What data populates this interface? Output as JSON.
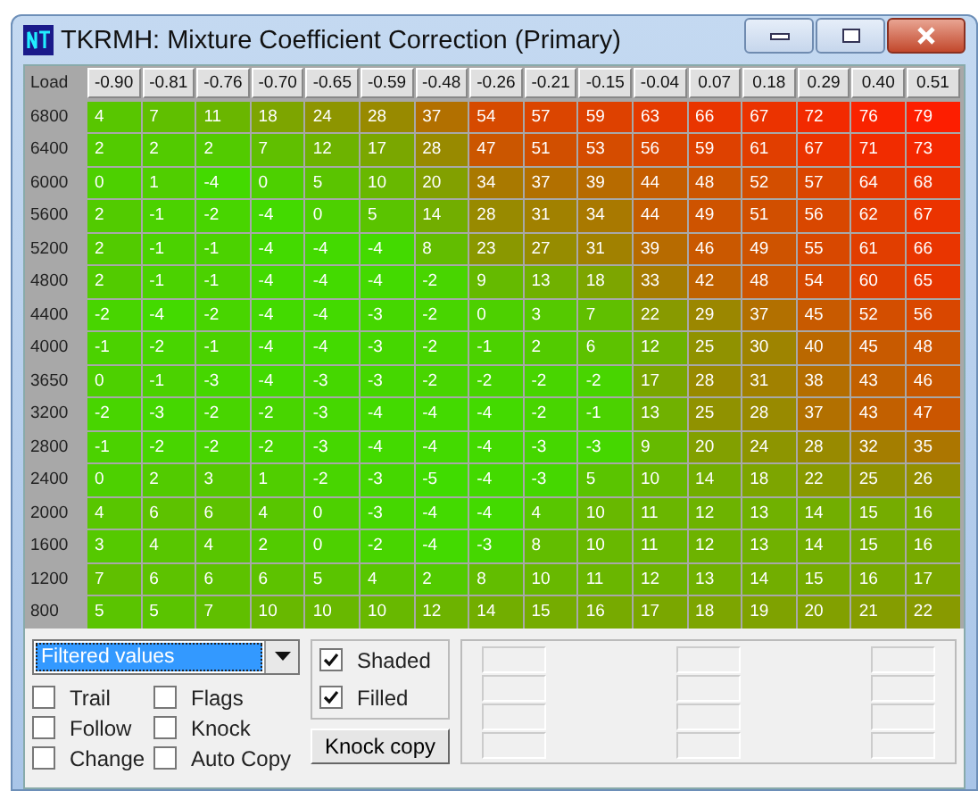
{
  "window": {
    "title": "TKRMH: Mixture Coefficient Correction (Primary)"
  },
  "table": {
    "corner": "Load",
    "columns": [
      "-0.90",
      "-0.81",
      "-0.76",
      "-0.70",
      "-0.65",
      "-0.59",
      "-0.48",
      "-0.26",
      "-0.21",
      "-0.15",
      "-0.04",
      "0.07",
      "0.18",
      "0.29",
      "0.40",
      "0.51"
    ],
    "rows": [
      {
        "label": "6800",
        "values": [
          "4",
          "7",
          "11",
          "18",
          "24",
          "28",
          "37",
          "54",
          "57",
          "59",
          "63",
          "66",
          "67",
          "72",
          "76",
          "79"
        ]
      },
      {
        "label": "6400",
        "values": [
          "2",
          "2",
          "2",
          "7",
          "12",
          "17",
          "28",
          "47",
          "51",
          "53",
          "56",
          "59",
          "61",
          "67",
          "71",
          "73"
        ]
      },
      {
        "label": "6000",
        "values": [
          "0",
          "1",
          "-4",
          "0",
          "5",
          "10",
          "20",
          "34",
          "37",
          "39",
          "44",
          "48",
          "52",
          "57",
          "64",
          "68"
        ]
      },
      {
        "label": "5600",
        "values": [
          "2",
          "-1",
          "-2",
          "-4",
          "0",
          "5",
          "14",
          "28",
          "31",
          "34",
          "44",
          "49",
          "51",
          "56",
          "62",
          "67"
        ]
      },
      {
        "label": "5200",
        "values": [
          "2",
          "-1",
          "-1",
          "-4",
          "-4",
          "-4",
          "8",
          "23",
          "27",
          "31",
          "39",
          "46",
          "49",
          "55",
          "61",
          "66"
        ]
      },
      {
        "label": "4800",
        "values": [
          "2",
          "-1",
          "-1",
          "-4",
          "-4",
          "-4",
          "-2",
          "9",
          "13",
          "18",
          "33",
          "42",
          "48",
          "54",
          "60",
          "65"
        ]
      },
      {
        "label": "4400",
        "values": [
          "-2",
          "-4",
          "-2",
          "-4",
          "-4",
          "-3",
          "-2",
          "0",
          "3",
          "7",
          "22",
          "29",
          "37",
          "45",
          "52",
          "56"
        ]
      },
      {
        "label": "4000",
        "values": [
          "-1",
          "-2",
          "-1",
          "-4",
          "-4",
          "-3",
          "-2",
          "-1",
          "2",
          "6",
          "12",
          "25",
          "30",
          "40",
          "45",
          "48"
        ]
      },
      {
        "label": "3650",
        "values": [
          "0",
          "-1",
          "-3",
          "-4",
          "-3",
          "-3",
          "-2",
          "-2",
          "-2",
          "-2",
          "17",
          "28",
          "31",
          "38",
          "43",
          "46"
        ]
      },
      {
        "label": "3200",
        "values": [
          "-2",
          "-3",
          "-2",
          "-2",
          "-3",
          "-4",
          "-4",
          "-4",
          "-2",
          "-1",
          "13",
          "25",
          "28",
          "37",
          "43",
          "47"
        ]
      },
      {
        "label": "2800",
        "values": [
          "-1",
          "-2",
          "-2",
          "-2",
          "-3",
          "-4",
          "-4",
          "-4",
          "-3",
          "-3",
          "9",
          "20",
          "24",
          "28",
          "32",
          "35"
        ]
      },
      {
        "label": "2400",
        "values": [
          "0",
          "2",
          "3",
          "1",
          "-2",
          "-3",
          "-5",
          "-4",
          "-3",
          "5",
          "10",
          "14",
          "18",
          "22",
          "25",
          "26"
        ]
      },
      {
        "label": "2000",
        "values": [
          "4",
          "6",
          "6",
          "4",
          "0",
          "-3",
          "-4",
          "-4",
          "4",
          "10",
          "11",
          "12",
          "13",
          "14",
          "15",
          "16"
        ]
      },
      {
        "label": "1600",
        "values": [
          "3",
          "4",
          "4",
          "2",
          "0",
          "-2",
          "-4",
          "-3",
          "8",
          "10",
          "11",
          "12",
          "13",
          "14",
          "15",
          "16"
        ]
      },
      {
        "label": "1200",
        "values": [
          "7",
          "6",
          "6",
          "6",
          "5",
          "4",
          "2",
          "8",
          "10",
          "11",
          "12",
          "13",
          "14",
          "15",
          "16",
          "17"
        ]
      },
      {
        "label": "800",
        "values": [
          "5",
          "5",
          "7",
          "10",
          "10",
          "10",
          "12",
          "14",
          "15",
          "16",
          "17",
          "18",
          "19",
          "20",
          "21",
          "22"
        ]
      }
    ]
  },
  "controls": {
    "dropdown": {
      "value": "Filtered values"
    },
    "options": [
      {
        "label": "Trail",
        "checked": false
      },
      {
        "label": "Flags",
        "checked": false
      },
      {
        "label": "Follow",
        "checked": false
      },
      {
        "label": "Knock",
        "checked": false
      },
      {
        "label": "Change",
        "checked": false
      },
      {
        "label": "Auto Copy",
        "checked": false
      }
    ],
    "display": [
      {
        "label": "Shaded",
        "checked": true
      },
      {
        "label": "Filled",
        "checked": true
      }
    ],
    "button": "Knock copy"
  }
}
